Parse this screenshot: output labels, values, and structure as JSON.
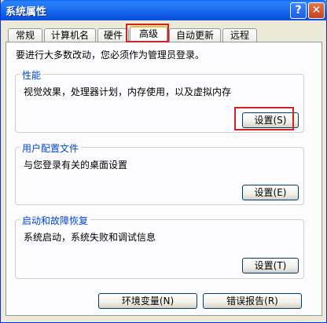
{
  "window": {
    "title": "系统属性",
    "help_glyph": "?",
    "close_glyph": "✕"
  },
  "tabs": [
    {
      "label": "常规"
    },
    {
      "label": "计算机名"
    },
    {
      "label": "硬件"
    },
    {
      "label": "高级"
    },
    {
      "label": "自动更新"
    },
    {
      "label": "远程"
    }
  ],
  "intro": "要进行大多数改动，您必须作为管理员登录。",
  "performance": {
    "title": "性能",
    "desc": "视觉效果，处理器计划，内存使用，以及虚拟内存",
    "button": "设置(S)"
  },
  "user_profiles": {
    "title": "用户配置文件",
    "desc": "与您登录有关的桌面设置",
    "button": "设置(E)"
  },
  "startup_recovery": {
    "title": "启动和故障恢复",
    "desc": "系统启动，系统失败和调试信息",
    "button": "设置(T)"
  },
  "bottom": {
    "env_button": "环境变量(N)",
    "error_button": "错误报告(R)"
  },
  "colors": {
    "highlight": "#d32222",
    "group_title": "#0046d5"
  }
}
